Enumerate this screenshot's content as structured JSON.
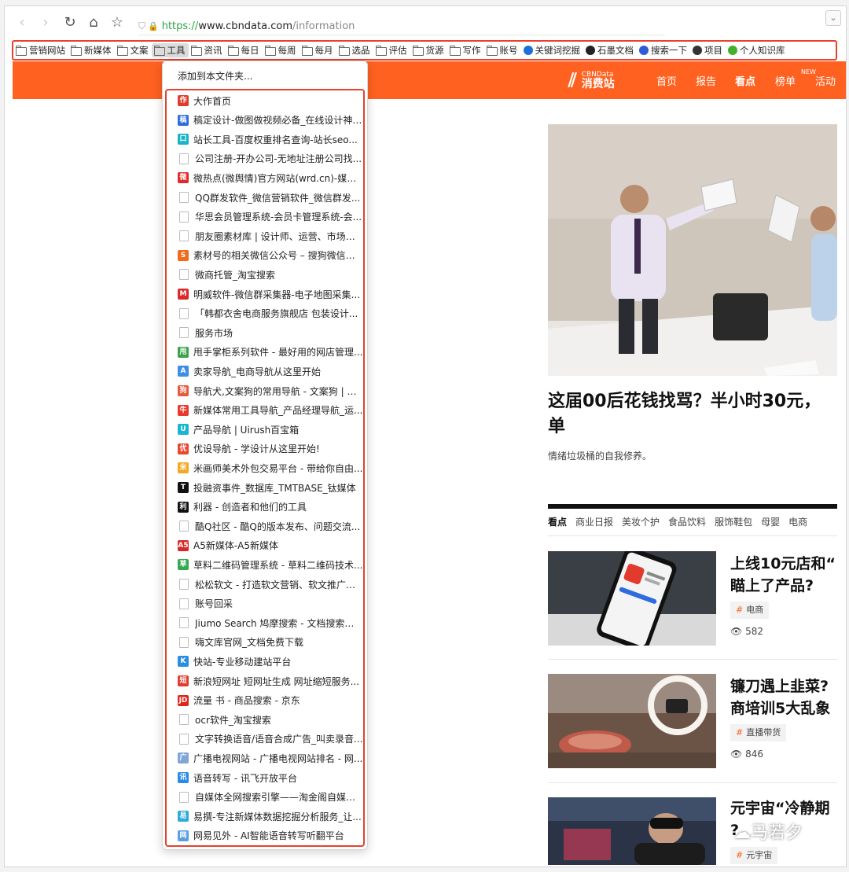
{
  "browser": {
    "url_scheme": "https://",
    "url_domain": "www.cbndata.com",
    "url_path": "/information",
    "collapse": "⌄"
  },
  "bookmarks_bar": [
    {
      "label": "营销网站",
      "type": "folder"
    },
    {
      "label": "新媒体",
      "type": "folder"
    },
    {
      "label": "文案",
      "type": "folder"
    },
    {
      "label": "工具",
      "type": "folder",
      "active": true
    },
    {
      "label": "资讯",
      "type": "folder"
    },
    {
      "label": "每日",
      "type": "folder"
    },
    {
      "label": "每周",
      "type": "folder"
    },
    {
      "label": "每月",
      "type": "folder"
    },
    {
      "label": "选品",
      "type": "folder"
    },
    {
      "label": "评估",
      "type": "folder"
    },
    {
      "label": "货源",
      "type": "folder"
    },
    {
      "label": "写作",
      "type": "folder"
    },
    {
      "label": "账号",
      "type": "folder"
    },
    {
      "label": "关键词挖掘",
      "type": "site",
      "color": "#1e6fd9"
    },
    {
      "label": "石墨文档",
      "type": "site",
      "color": "#222222"
    },
    {
      "label": "搜索一下",
      "type": "site",
      "color": "#2f5bd8"
    },
    {
      "label": "项目",
      "type": "site",
      "color": "#333333"
    },
    {
      "label": "个人知识库",
      "type": "site",
      "color": "#43b02a"
    }
  ],
  "dropdown": {
    "add_to_folder": "添加到本文件夹...",
    "items": [
      {
        "label": "大作首页",
        "icon": "#e23b2e",
        "glyph": "作"
      },
      {
        "label": "稿定设计-做图做视频必备_在线设计神器...",
        "icon": "#2d6be0",
        "glyph": "稿"
      },
      {
        "label": "站长工具-百度权重排名查询-站长seo...",
        "icon": "#18b3c7",
        "glyph": "口"
      },
      {
        "label": "公司注册-开办公司-无地址注册公司找...",
        "icon": "doc"
      },
      {
        "label": "微热点(微舆情)官方网站(wrd.cn)-媒体...",
        "icon": "#e02a2a",
        "glyph": "微"
      },
      {
        "label": "QQ群发软件_微信营销软件_微信群发...",
        "icon": "doc"
      },
      {
        "label": "华思会员管理系统-会员卡管理系统-会...",
        "icon": "doc"
      },
      {
        "label": "朋友圈素材库 | 设计师、运营、市场、...",
        "icon": "doc"
      },
      {
        "label": "素材号的相关微信公众号 – 搜狗微信搜...",
        "icon": "#f26a1b",
        "glyph": "S"
      },
      {
        "label": "微商托管_淘宝搜索",
        "icon": "doc"
      },
      {
        "label": "明威软件-微信群采集器-电子地图采集...",
        "icon": "#d92b2b",
        "glyph": "M"
      },
      {
        "label": "「韩都衣舍电商服务旗舰店 包装设计...",
        "icon": "doc"
      },
      {
        "label": "服务市场",
        "icon": "doc"
      },
      {
        "label": "甩手掌柜系列软件 - 最好用的网店管理...",
        "icon": "#3aa34a",
        "glyph": "甩"
      },
      {
        "label": "卖家导航_电商导航从这里开始",
        "icon": "#3c8ee8",
        "glyph": "A"
      },
      {
        "label": "导航犬,文案狗的常用导航 - 文案狗 | 给...",
        "icon": "#e45a3a",
        "glyph": "狗"
      },
      {
        "label": "新媒体常用工具导航_产品经理导航_运...",
        "icon": "#e8392d",
        "glyph": "牛"
      },
      {
        "label": "产品导航 | Uirush百宝箱",
        "icon": "#18b6d0",
        "glyph": "U"
      },
      {
        "label": "优设导航 - 学设计从这里开始!",
        "icon": "#e8472d",
        "glyph": "优"
      },
      {
        "label": "米画师美术外包交易平台 - 带给你自由...",
        "icon": "#f5a623",
        "glyph": "米"
      },
      {
        "label": "投融资事件_数据库_TMTBASE_钛媒体",
        "icon": "#111111",
        "glyph": "T"
      },
      {
        "label": "利器 - 创造者和他们的工具",
        "icon": "#111111",
        "glyph": "利"
      },
      {
        "label": "酷Q社区 - 酷Q的版本发布、问题交流...",
        "icon": "doc"
      },
      {
        "label": "A5新媒体-A5新媒体",
        "icon": "#d62828",
        "glyph": "A5"
      },
      {
        "label": "草料二维码管理系统 - 草料二维码技术...",
        "icon": "#37a852",
        "glyph": "草"
      },
      {
        "label": "松松软文 - 打造软文营销、软文推广行...",
        "icon": "doc"
      },
      {
        "label": "账号回采",
        "icon": "doc"
      },
      {
        "label": "Jiumo Search 鸠摩搜索 - 文档搜索引擎",
        "icon": "doc"
      },
      {
        "label": "嗨文库官网_文档免费下载",
        "icon": "doc"
      },
      {
        "label": "快站-专业移动建站平台",
        "icon": "#2a8ee0",
        "glyph": "K"
      },
      {
        "label": "新浪短网址 短网址生成 网址缩短服务...",
        "icon": "#e33b2e",
        "glyph": "短"
      },
      {
        "label": "流量 书 - 商品搜索 - 京东",
        "icon": "#e1251b",
        "glyph": "JD"
      },
      {
        "label": "ocr软件_淘宝搜索",
        "icon": "doc"
      },
      {
        "label": "文字转换语音/语音合成广告_叫卖录音...",
        "icon": "doc"
      },
      {
        "label": "广播电视网站 - 广播电视网站排名 - 网...",
        "icon": "#7fa6d6",
        "glyph": "广"
      },
      {
        "label": "语音转写 - 讯飞开放平台",
        "icon": "#2b8be6",
        "glyph": "讯"
      },
      {
        "label": "自媒体全网搜索引擎——淘金阁自媒体...",
        "icon": "doc"
      },
      {
        "label": "易撰-专注新媒体数据挖掘分析服务_让...",
        "icon": "#2fa9d9",
        "glyph": "易"
      },
      {
        "label": "网易见外 - AI智能语音转写听翻平台",
        "icon": "#5aa0e0",
        "glyph": "网"
      }
    ]
  },
  "site": {
    "logo_small": "CBNData",
    "logo_big": "消费站",
    "nav": [
      "首页",
      "报告",
      "看点",
      "榜单",
      "活动"
    ],
    "new_badge": "NEW",
    "headline_line1": "这届00后花钱找骂？半小时30元，",
    "headline_line2": "单",
    "subtitle": "情绪垃圾桶的自我修养。",
    "tabs": [
      "看点",
      "商业日报",
      "美妆个护",
      "食品饮料",
      "服饰鞋包",
      "母婴",
      "电商"
    ],
    "articles": [
      {
        "title1": "上线10元店和“",
        "title2": "瞄上了产品?",
        "tag": "电商",
        "views": "582"
      },
      {
        "title1": "镰刀遇上韭菜?",
        "title2": "商培训5大乱象",
        "tag": "直播带货",
        "views": "846"
      },
      {
        "title1": "元宇宙“冷静期",
        "title2": "?",
        "tag": "元宇宙",
        "views": ""
      }
    ],
    "watermark": "马若夕"
  }
}
